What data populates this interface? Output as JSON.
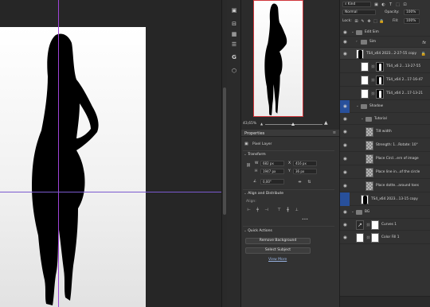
{
  "navigator": {
    "zoom": "43,65%",
    "mountain_small": "▲",
    "mountain_large": "▲"
  },
  "properties": {
    "tab_title": "Properties",
    "menu_icon": "≡",
    "layer_kind": "Pixel Layer",
    "transform_title": "Transform",
    "w_label": "W",
    "w_value": "682 px",
    "h_label": "H",
    "h_value": "1947 px",
    "x_label": "X",
    "x_value": "416 px",
    "y_label": "Y",
    "y_value": "36 px",
    "angle_value": "0,00°",
    "align_title": "Align and Distribute",
    "align_sub": "Align:",
    "more": "•••",
    "quick_actions_title": "Quick Actions",
    "remove_bg_label": "Remove Background",
    "select_subject_label": "Select Subject",
    "view_more_label": "View More"
  },
  "layers_panel": {
    "search_kind": "Kind",
    "blend_mode": "Normal",
    "opacity_label": "Opacity:",
    "opacity_value": "100%",
    "lock_label": "Lock:",
    "fill_label": "Fill:",
    "fill_value": "100%",
    "layers": [
      {
        "name": "Edit Sim",
        "type": "group",
        "indent": 0,
        "visible": true,
        "twirl": "⌄"
      },
      {
        "name": "Sim",
        "type": "group",
        "indent": 1,
        "visible": true,
        "twirl": "›",
        "fx": "fx"
      },
      {
        "name": "TS4_x64 2023...2-27-55 copy",
        "type": "pixel",
        "indent": 1,
        "visible": true,
        "lock": "🔒"
      },
      {
        "name": "TS4_x6 2...13-27-55",
        "type": "masked",
        "indent": 2,
        "visible": false
      },
      {
        "name": "TS4_x64 2...17-16-47",
        "type": "masked",
        "indent": 2,
        "visible": false
      },
      {
        "name": "TS4_x64 2...17-13-21",
        "type": "masked",
        "indent": 2,
        "visible": false
      },
      {
        "name": "Shadow",
        "type": "group",
        "indent": 1,
        "visible": true,
        "twirl": "⌄",
        "highlight": true
      },
      {
        "name": "Tutorial",
        "type": "group",
        "indent": 2,
        "visible": true,
        "twirl": "⌄"
      },
      {
        "name": "Tilt width",
        "type": "text",
        "indent": 3,
        "visible": true
      },
      {
        "name": "Strength: 1...Rotate: 10°",
        "type": "text",
        "indent": 3,
        "visible": true
      },
      {
        "name": "Place Circl...ern of image",
        "type": "text",
        "indent": 3,
        "visible": true
      },
      {
        "name": "Place line in...of the circle",
        "type": "text",
        "indent": 3,
        "visible": true
      },
      {
        "name": "Place dotte...around toes",
        "type": "text",
        "indent": 3,
        "visible": true
      },
      {
        "name": "TS4_x64 2023...13-15 copy",
        "type": "pixel-dark",
        "indent": 2,
        "visible": false,
        "highlight": true
      },
      {
        "name": "BG",
        "type": "group",
        "indent": 0,
        "visible": true,
        "twirl": "⌄"
      },
      {
        "name": "Curves 1",
        "type": "adjust",
        "indent": 1,
        "visible": true
      },
      {
        "name": "Color Fill 1",
        "type": "fill",
        "indent": 1,
        "visible": true
      }
    ]
  },
  "colors": {
    "guide": "#a044d8",
    "selection_accent": "#28509b",
    "nav_frame": "#d0363b"
  }
}
